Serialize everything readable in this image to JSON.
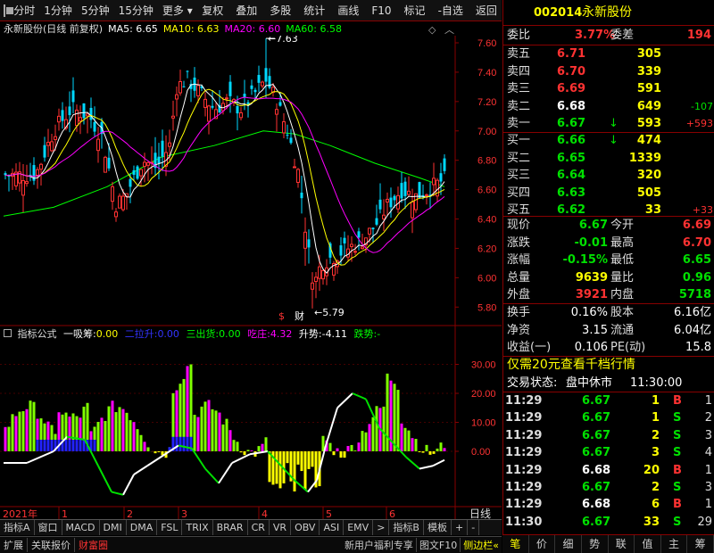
{
  "toolbar": {
    "items": [
      "分时",
      "1分钟",
      "5分钟",
      "15分钟",
      "更多",
      "复权",
      "叠加",
      "多股",
      "统计",
      "画线",
      "F10",
      "标记",
      "-自选",
      "返回"
    ]
  },
  "main_header": {
    "title": "永新股份(日线 前复权)",
    "ma5": "MA5: 6.65",
    "ma10": "MA10: 6.63",
    "ma20": "MA20: 6.60",
    "ma60": "MA60: 6.58"
  },
  "price_axis": [
    "7.60",
    "7.40",
    "7.20",
    "7.00",
    "6.80",
    "6.60",
    "6.40",
    "6.20",
    "6.00",
    "5.80"
  ],
  "indicator_axis": [
    "30.00",
    "20.00",
    "10.00",
    "0.00"
  ],
  "high_label": "7.63",
  "low_label": "5.79",
  "event_markers": [
    "$",
    "财"
  ],
  "indicator_header": {
    "name": "指标公式",
    "a_label": "一吸筹:",
    "a_val": "0.00",
    "b_label": "二拉升:",
    "b_val": "0.00",
    "c_label": "三出货:",
    "c_val": "0.00",
    "d_label": "吃庄:",
    "d_val": "4.32",
    "e_label": "升势:",
    "e_val": "-4.11",
    "f_label": "跌势:",
    "f_val": "-"
  },
  "x_axis": {
    "year": "2021年",
    "months": [
      "1",
      "2",
      "3",
      "4",
      "5",
      "6"
    ],
    "right": "日线"
  },
  "bottom_tabs": [
    "指标A",
    "窗口",
    "MACD",
    "DMI",
    "DMA",
    "FSL",
    "TRIX",
    "BRAR",
    "CR",
    "VR",
    "OBV",
    "ASI",
    "EMV",
    ">",
    "指标B",
    "模板",
    "+",
    "-"
  ],
  "status_bar": {
    "left": [
      "扩展",
      "关联报价",
      "财富圈"
    ],
    "right": [
      "新用户福利专享",
      "图文F10",
      "侧边栏"
    ]
  },
  "panel": {
    "code": "002014",
    "name": "永新股份",
    "weibi_label": "委比",
    "weibi": "3.77%",
    "weicha_label": "委差",
    "weicha": "194",
    "sells": [
      {
        "label": "卖五",
        "price": "6.71",
        "vol": "305",
        "chg": ""
      },
      {
        "label": "卖四",
        "price": "6.70",
        "vol": "339",
        "chg": ""
      },
      {
        "label": "卖三",
        "price": "6.69",
        "vol": "591",
        "chg": ""
      },
      {
        "label": "卖二",
        "price": "6.68",
        "vol": "649",
        "chg": "-107"
      },
      {
        "label": "卖一",
        "price": "6.67",
        "vol": "593",
        "chg": "+593"
      }
    ],
    "buys": [
      {
        "label": "买一",
        "price": "6.66",
        "vol": "474",
        "chg": ""
      },
      {
        "label": "买二",
        "price": "6.65",
        "vol": "1339",
        "chg": ""
      },
      {
        "label": "买三",
        "price": "6.64",
        "vol": "320",
        "chg": ""
      },
      {
        "label": "买四",
        "price": "6.63",
        "vol": "505",
        "chg": ""
      },
      {
        "label": "买五",
        "price": "6.62",
        "vol": "33",
        "chg": "+33"
      }
    ],
    "stats": [
      {
        "l1": "现价",
        "v1": "6.67",
        "l2": "今开",
        "v2": "6.69"
      },
      {
        "l1": "涨跌",
        "v1": "-0.01",
        "l2": "最高",
        "v2": "6.70"
      },
      {
        "l1": "涨幅",
        "v1": "-0.15%",
        "l2": "最低",
        "v2": "6.65"
      },
      {
        "l1": "总量",
        "v1": "9639",
        "l2": "量比",
        "v2": "0.96"
      },
      {
        "l1": "外盘",
        "v1": "3921",
        "l2": "内盘",
        "v2": "5718"
      }
    ],
    "stats2": [
      {
        "l1": "换手",
        "v1": "0.16%",
        "l2": "股本",
        "v2": "6.16亿"
      },
      {
        "l1": "净资",
        "v1": "3.15",
        "l2": "流通",
        "v2": "6.04亿"
      },
      {
        "l1": "收益(一)",
        "v1": "0.106",
        "l2": "PE(动)",
        "v2": "15.8"
      }
    ],
    "promo": "仅需20元查看千档行情",
    "trade_state_label": "交易状态:",
    "trade_state": "盘中休市",
    "trade_time": "11:30:00",
    "ticks": [
      {
        "time": "11:29",
        "price": "6.67",
        "vol": "1",
        "dir": "B",
        "n": "1"
      },
      {
        "time": "11:29",
        "price": "6.67",
        "vol": "1",
        "dir": "S",
        "n": "2"
      },
      {
        "time": "11:29",
        "price": "6.67",
        "vol": "2",
        "dir": "S",
        "n": "3"
      },
      {
        "time": "11:29",
        "price": "6.67",
        "vol": "3",
        "dir": "S",
        "n": "4"
      },
      {
        "time": "11:29",
        "price": "6.68",
        "vol": "20",
        "dir": "B",
        "n": "1"
      },
      {
        "time": "11:29",
        "price": "6.67",
        "vol": "2",
        "dir": "S",
        "n": "3"
      },
      {
        "time": "11:29",
        "price": "6.68",
        "vol": "6",
        "dir": "B",
        "n": "1"
      },
      {
        "time": "11:30",
        "price": "6.67",
        "vol": "33",
        "dir": "S",
        "n": "29"
      }
    ],
    "bottom_buttons": [
      "笔",
      "价",
      "细",
      "势",
      "联",
      "值",
      "主",
      "筹"
    ]
  },
  "colors": {
    "up": "#ff3232",
    "down": "#00e000",
    "flat": "#ffffff",
    "ma5": "#ffffff",
    "ma10": "#ffff00",
    "ma20": "#ff00ff",
    "ma60": "#00ff00",
    "accent": "#ffff00",
    "border": "#800000"
  }
}
